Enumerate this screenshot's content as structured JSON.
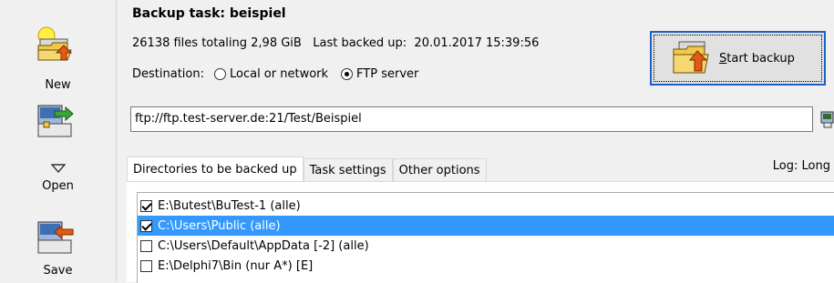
{
  "toolbar": {
    "new_label": "New",
    "open_label": "Open",
    "save_label": "Save"
  },
  "task": {
    "title": "Backup task: beispiel",
    "file_info": "26138 files totaling 2,98 GiB",
    "last_backup_label": "Last backed up:",
    "last_backup_value": "20.01.2017 15:39:56",
    "destination_label": "Destination:",
    "destination_options": [
      {
        "label": "Local or network",
        "checked": false
      },
      {
        "label": "FTP server",
        "checked": true
      }
    ],
    "start_button_prefix": "S",
    "start_button_rest": "tart backup",
    "url": "ftp://ftp.test-server.de:21/Test/Beispiel"
  },
  "tabs": [
    {
      "label": "Directories to be backed up",
      "active": true
    },
    {
      "label": "Task settings",
      "active": false
    },
    {
      "label": "Other options",
      "active": false
    }
  ],
  "log_label": "Log: Long",
  "directories": [
    {
      "path": "E:\\Butest\\BuTest-1 (alle)",
      "checked": true,
      "selected": false
    },
    {
      "path": "C:\\Users\\Public (alle)",
      "checked": true,
      "selected": true
    },
    {
      "path": "C:\\Users\\Default\\AppData [-2] (alle)",
      "checked": false,
      "selected": false
    },
    {
      "path": "E:\\Delphi7\\Bin (nur A*) [E]",
      "checked": false,
      "selected": false
    }
  ],
  "colors": {
    "selection": "#3399ff",
    "focus_border": "#1c62c6",
    "background": "#f0f0f0"
  }
}
